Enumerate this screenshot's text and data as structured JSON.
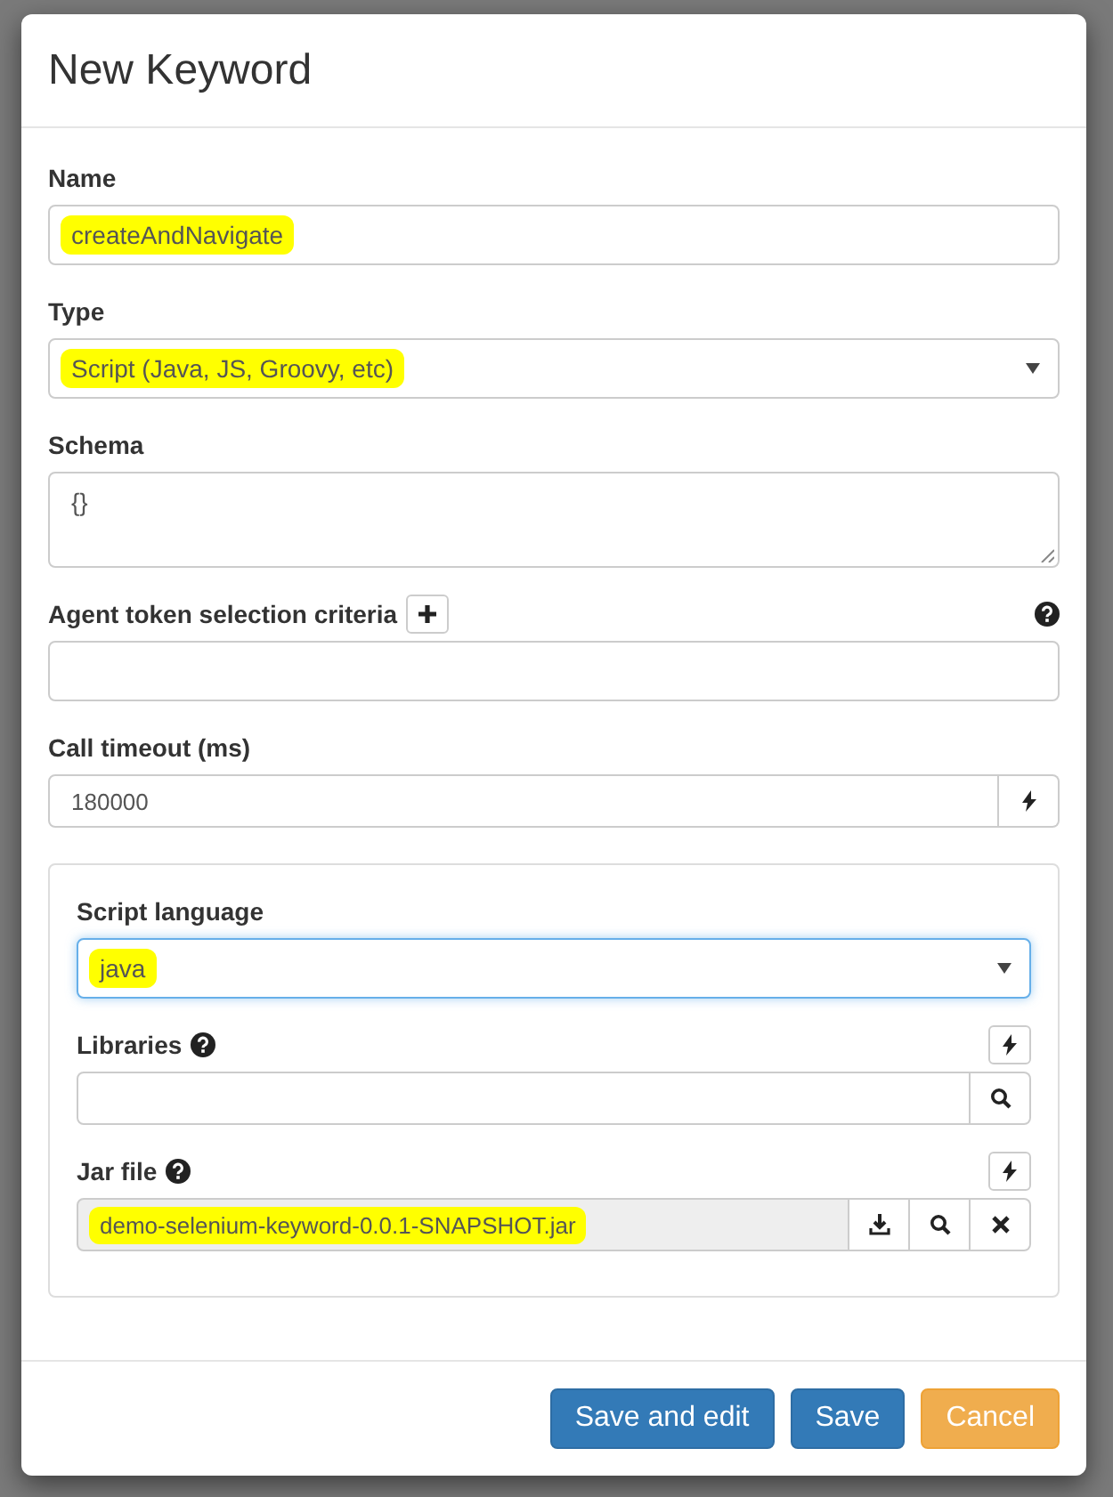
{
  "dialog": {
    "title": "New Keyword",
    "fields": [
      {
        "kind": "text",
        "label": "Name",
        "value": "createAndNavigate",
        "highlighted": true
      },
      {
        "kind": "select",
        "label": "Type",
        "value": "Script (Java, JS, Groovy, etc)",
        "highlighted": true
      },
      {
        "kind": "textarea",
        "label": "Schema",
        "value": "{}",
        "highlighted": false
      },
      {
        "kind": "criteria",
        "label": "Agent token selection criteria"
      },
      {
        "kind": "dynamic",
        "label": "Call timeout (ms)",
        "value": "180000",
        "highlighted": false
      }
    ],
    "script_panel": [
      {
        "kind": "select",
        "label": "Script language",
        "value": "java",
        "highlighted": true,
        "focused": true
      },
      {
        "kind": "resource",
        "label": "Libraries",
        "readonly": false
      },
      {
        "kind": "resource",
        "label": "Jar file",
        "value": "demo-selenium-keyword-0.0.1-SNAPSHOT.jar",
        "highlighted": true,
        "readonly": true
      }
    ],
    "buttons": [
      {
        "label": "Save and edit",
        "kind": "primary"
      },
      {
        "label": "Save",
        "kind": "primary"
      },
      {
        "label": "Cancel",
        "kind": "warning"
      }
    ]
  }
}
